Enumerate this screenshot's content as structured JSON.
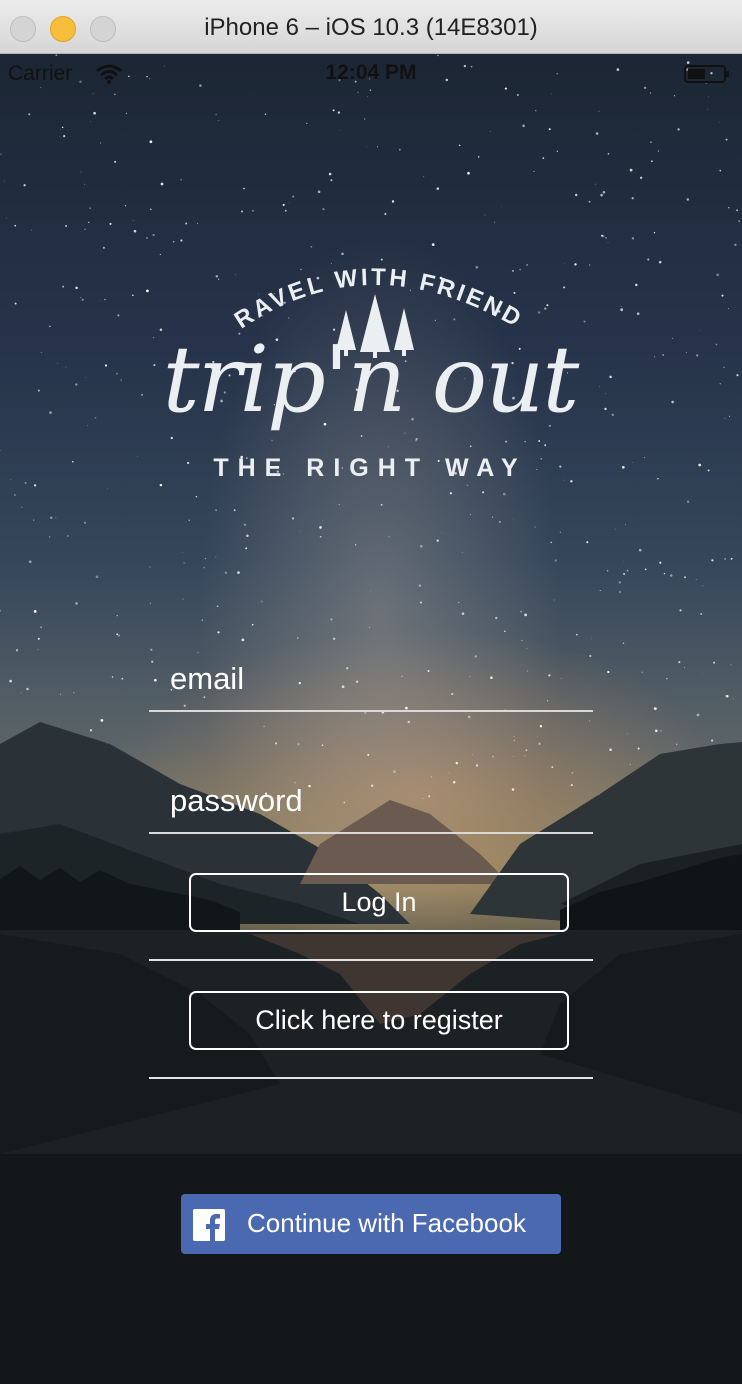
{
  "window": {
    "title": "iPhone 6 – iOS 10.3 (14E8301)"
  },
  "status_bar": {
    "carrier": "Carrier",
    "time": "12:04 PM"
  },
  "logo": {
    "top_tagline": "TRAVEL WITH FRIENDS",
    "wordmark": "trip'n out",
    "bottom_tagline": "THE RIGHT WAY"
  },
  "login_form": {
    "email_placeholder": "email",
    "password_placeholder": "password",
    "login_label": "Log In",
    "register_label": "Click here to register"
  },
  "facebook": {
    "label": "Continue with Facebook",
    "icon": "facebook-icon",
    "color": "#4b69b0"
  }
}
